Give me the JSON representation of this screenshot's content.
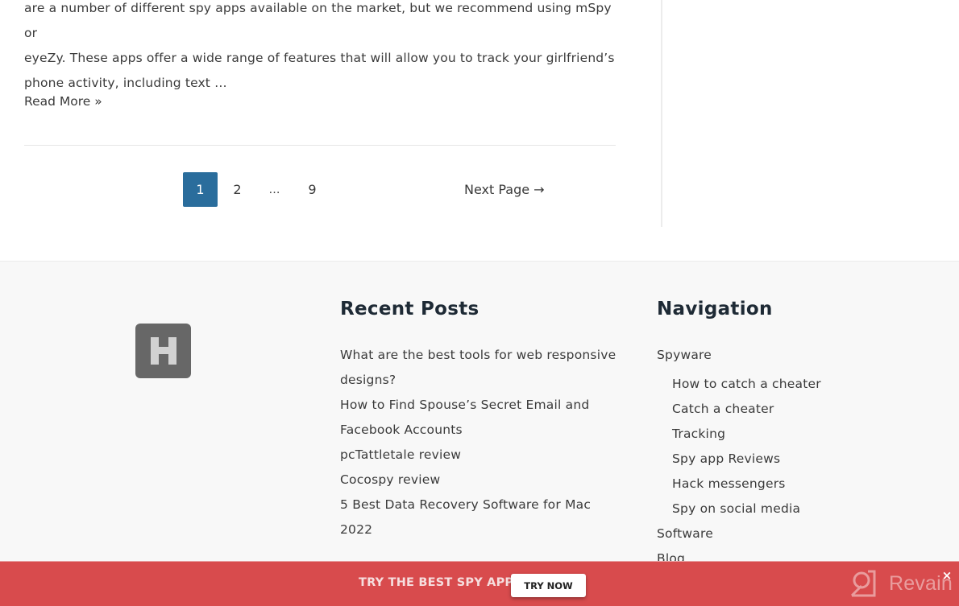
{
  "article": {
    "excerpt_lines": [
      "are a number of different spy apps available on the market, but we recommend using mSpy or",
      "eyeZy. These apps offer a wide range of features that will allow you to track your girlfriend’s",
      "phone activity, including text …"
    ],
    "read_more_label": "Read More »"
  },
  "pagination": {
    "pages": [
      "1",
      "2",
      "…",
      "9"
    ],
    "current_page": "1",
    "next_label": "Next Page →"
  },
  "footer": {
    "logo_letter": "H",
    "recent_posts": {
      "title": "Recent Posts",
      "items": [
        "What are the best tools for web responsive designs?￼",
        "How to Find Spouse’s Secret Email and Facebook Accounts￼",
        "pcTattletale review",
        "Cocospy review",
        "5 Best Data Recovery Software for Mac 2022"
      ]
    },
    "navigation": {
      "title": "Navigation",
      "items": [
        {
          "label": "Spyware",
          "level": 0
        },
        {
          "label": "How to catch a cheater",
          "level": 1
        },
        {
          "label": "Catch a cheater",
          "level": 1
        },
        {
          "label": "Tracking",
          "level": 1
        },
        {
          "label": "Spy app Reviews",
          "level": 1
        },
        {
          "label": "Hack messengers",
          "level": 1
        },
        {
          "label": "Spy on social media",
          "level": 1
        },
        {
          "label": "Software",
          "level": 0
        },
        {
          "label": "Blog",
          "level": 0
        }
      ]
    }
  },
  "promo": {
    "text": "TRY THE BEST SPY APP",
    "button_label": "TRY NOW",
    "close_label": "×",
    "watermark": "Revain"
  },
  "colors": {
    "accent": "#2a6d9c",
    "promo_bg": "#d84b4d",
    "footer_bg": "#f8f8f8",
    "heading": "#1e2a35"
  }
}
